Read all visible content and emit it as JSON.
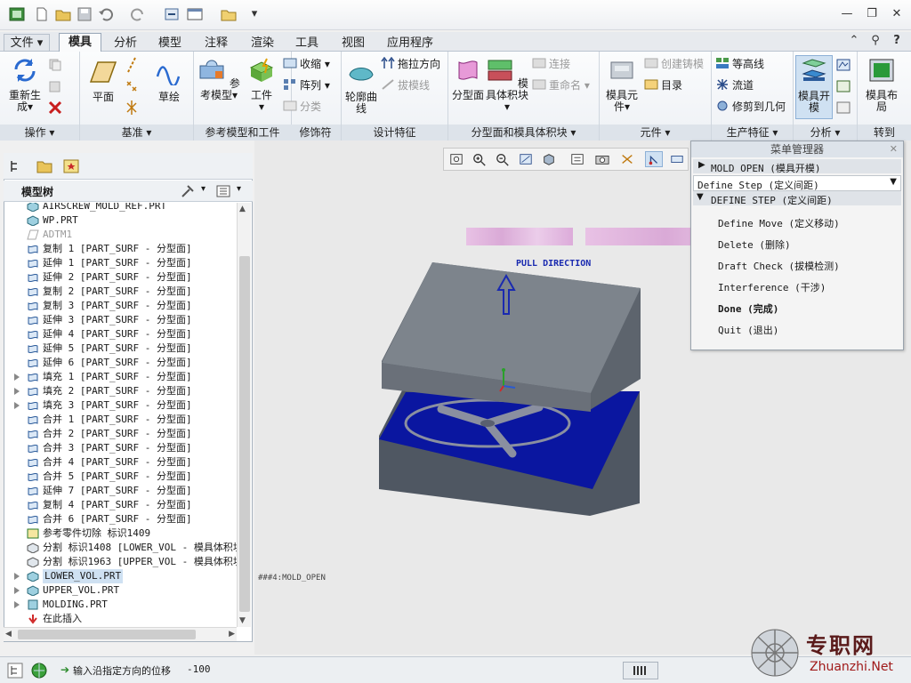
{
  "tabs": [
    "文件",
    "模具",
    "分析",
    "模型",
    "注释",
    "渲染",
    "工具",
    "视图",
    "应用程序"
  ],
  "ribbon": {
    "groups": {
      "operations": "操作",
      "datum": "基准",
      "ref_model": "参考模型和工件",
      "modifiers": "修饰符",
      "design_features": "设计特征",
      "parting": "分型面和模具体积块",
      "components": "元件",
      "production": "生产特征",
      "analysis": "分析",
      "goto": "转到"
    },
    "buttons": {
      "regenerate": "重新生成",
      "plane": "平面",
      "sketch": "草绘",
      "ref_model": "参考模型",
      "workpiece": "工件",
      "shrink": "收缩",
      "pattern": "阵列",
      "classify": "分类",
      "contour_curve": "轮廓曲线",
      "drag_direction": "拖拉方向",
      "draft_line": "拔模线",
      "parting_surface": "分型面",
      "mold_volume": "模具体积块",
      "connect": "连接",
      "rename": "重命名",
      "mold_component": "模具元件",
      "create_casting": "创建铸模",
      "directory": "目录",
      "contour_lines": "等高线",
      "runner": "流道",
      "trim_to_geometry": "修剪到几何",
      "mold_open": "模具开模",
      "mold_layout": "模具布局"
    }
  },
  "model_tree": {
    "title": "模型树",
    "items": [
      {
        "label": "AIRSCREW_MOLD_REF.PRT",
        "expand": false,
        "icon": "part"
      },
      {
        "label": "WP.PRT",
        "expand": false,
        "icon": "part"
      },
      {
        "label": "ADTM1",
        "expand": false,
        "icon": "datum",
        "dim": true
      },
      {
        "label": "复制 1 [PART_SURF - 分型面]",
        "expand": false,
        "icon": "surface"
      },
      {
        "label": "延伸 1 [PART_SURF - 分型面]",
        "expand": false,
        "icon": "surface"
      },
      {
        "label": "延伸 2 [PART_SURF - 分型面]",
        "expand": false,
        "icon": "surface"
      },
      {
        "label": "复制 2 [PART_SURF - 分型面]",
        "expand": false,
        "icon": "surface"
      },
      {
        "label": "复制 3 [PART_SURF - 分型面]",
        "expand": false,
        "icon": "surface"
      },
      {
        "label": "延伸 3 [PART_SURF - 分型面]",
        "expand": false,
        "icon": "surface"
      },
      {
        "label": "延伸 4 [PART_SURF - 分型面]",
        "expand": false,
        "icon": "surface"
      },
      {
        "label": "延伸 5 [PART_SURF - 分型面]",
        "expand": false,
        "icon": "surface"
      },
      {
        "label": "延伸 6 [PART_SURF - 分型面]",
        "expand": false,
        "icon": "surface"
      },
      {
        "label": "填充 1 [PART_SURF - 分型面]",
        "expand": true,
        "icon": "surface"
      },
      {
        "label": "填充 2 [PART_SURF - 分型面]",
        "expand": true,
        "icon": "surface"
      },
      {
        "label": "填充 3 [PART_SURF - 分型面]",
        "expand": true,
        "icon": "surface"
      },
      {
        "label": "合并 1 [PART_SURF - 分型面]",
        "expand": false,
        "icon": "surface"
      },
      {
        "label": "合并 2 [PART_SURF - 分型面]",
        "expand": false,
        "icon": "surface"
      },
      {
        "label": "合并 3 [PART_SURF - 分型面]",
        "expand": false,
        "icon": "surface"
      },
      {
        "label": "合并 4 [PART_SURF - 分型面]",
        "expand": false,
        "icon": "surface"
      },
      {
        "label": "合并 5 [PART_SURF - 分型面]",
        "expand": false,
        "icon": "surface"
      },
      {
        "label": "延伸 7 [PART_SURF - 分型面]",
        "expand": false,
        "icon": "surface"
      },
      {
        "label": "复制 4 [PART_SURF - 分型面]",
        "expand": false,
        "icon": "surface"
      },
      {
        "label": "合并 6 [PART_SURF - 分型面]",
        "expand": false,
        "icon": "surface"
      },
      {
        "label": "参考零件切除 标识1409",
        "expand": false,
        "icon": "cut"
      },
      {
        "label": "分割 标识1408 [LOWER_VOL - 模具体积块",
        "expand": false,
        "icon": "split"
      },
      {
        "label": "分割 标识1963 [UPPER_VOL - 模具体积块",
        "expand": false,
        "icon": "split"
      },
      {
        "label": "LOWER_VOL.PRT",
        "expand": true,
        "icon": "part",
        "selected": true
      },
      {
        "label": "UPPER_VOL.PRT",
        "expand": true,
        "icon": "part"
      },
      {
        "label": "MOLDING.PRT",
        "expand": true,
        "icon": "molding"
      },
      {
        "label": "在此插入",
        "expand": false,
        "icon": "insert"
      }
    ]
  },
  "viewport": {
    "pull_direction_label": "PULL DIRECTION",
    "model_label": "###4:MOLD_OPEN"
  },
  "menu_manager": {
    "title": "菜单管理器",
    "section": "MOLD OPEN (模具开模)",
    "dropdown": "Define Step (定义间距)",
    "subsection": "DEFINE STEP (定义间距)",
    "items": [
      {
        "label": "Define Move (定义移动)",
        "bold": false
      },
      {
        "label": "Delete (删除)",
        "bold": false
      },
      {
        "label": "Draft Check (拔模检测)",
        "bold": false
      },
      {
        "label": "Interference (干涉)",
        "bold": false
      },
      {
        "label": "Done (完成)",
        "bold": true
      },
      {
        "label": "Quit (退出)",
        "bold": false
      }
    ]
  },
  "status_bar": {
    "prompt": "输入沿指定方向的位移",
    "value": "-100"
  },
  "watermark": {
    "text": "专职网",
    "url": "Zhuanzhi.Net"
  },
  "colors": {
    "upper_mold": "#7d848c",
    "lower_mold_top": "#0a16a0",
    "lower_mold_side": "#4f5762",
    "pull_arrow": "#1a2ab0"
  }
}
